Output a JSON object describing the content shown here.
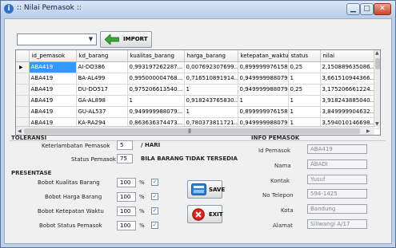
{
  "window": {
    "title": ":: Nilai Pemasok ::",
    "minimize": "▁",
    "maximize": "□",
    "close": "✕"
  },
  "toolbar": {
    "combo_value": "",
    "import_label": "IMPORT"
  },
  "grid": {
    "columns": [
      "id_pemasok",
      "kd_barang",
      "kualitas_barang",
      "harga_barang",
      "ketepatan_waktu",
      "status",
      "nilai"
    ],
    "rows": [
      [
        "ABA419",
        "AI-DO386",
        "0,993197262287...",
        "0,007692307699...",
        "0,899999976158...",
        "0,25",
        "2,150889635086..."
      ],
      [
        "ABA419",
        "BA-AL499",
        "0,995000004768...",
        "0,716510891914...",
        "0,949999988079...",
        "1",
        "3,661510944366..."
      ],
      [
        "ABA419",
        "DU-DO517",
        "0,975206613540...",
        "1",
        "0,949999988079...",
        "0,25",
        "3,175206661224..."
      ],
      [
        "ABA419",
        "GA-AL898",
        "1",
        "0,918243765830...",
        "1",
        "1",
        "3,918243885040..."
      ],
      [
        "ABA419",
        "GU-AL537",
        "0,949999988079...",
        "1",
        "0,899999976158...",
        "1",
        "3,849999904632..."
      ],
      [
        "ABA419",
        "KA-RA294",
        "0,863636374473...",
        "0,780373811721...",
        "0,949999988079...",
        "1",
        "3,594010146698..."
      ]
    ],
    "row_marker": "▶",
    "hscroll_grip": "|||"
  },
  "toleransi": {
    "heading": "TOLERANSI",
    "keterlambatan_label": "Keterlambatan Pemasok",
    "keterlambatan_dash": "-",
    "keterlambatan_value": "5",
    "keterlambatan_unit": "/ HARI",
    "status_label": "Status Pemasok",
    "status_dash": "-",
    "status_value": "75",
    "status_note": "BILA BARANG TIDAK TERSEDIA"
  },
  "presentase": {
    "heading": "PRESENTASE",
    "items": [
      {
        "label": "Bobot Kualitas Barang",
        "value": "100",
        "unit": "%",
        "checked": "✓"
      },
      {
        "label": "Bobot Harga Barang",
        "value": "100",
        "unit": "%",
        "checked": "✓"
      },
      {
        "label": "Bobot Ketepatan Waktu",
        "value": "100",
        "unit": "%",
        "checked": "✓"
      },
      {
        "label": "Bobot Status Pemasok",
        "value": "100",
        "unit": "%",
        "checked": "✓"
      }
    ]
  },
  "actions": {
    "save_label": "SAVE",
    "exit_label": "EXIT"
  },
  "info": {
    "heading": "INFO PEMASOK",
    "fields": [
      {
        "label": "Id Pemasok",
        "value": "ABA419"
      },
      {
        "label": "Nama",
        "value": "ABADI"
      },
      {
        "label": "Kontak",
        "value": "Yusuf"
      },
      {
        "label": "No Telepon",
        "value": "594-1425"
      },
      {
        "label": "Kota",
        "value": "Bandung"
      },
      {
        "label": "Alamat",
        "value": "Siliwangi A/17"
      }
    ]
  },
  "colors": {
    "selection": "#3399ff",
    "window_frame": "#bcd0ea",
    "close_button": "#c8442b"
  }
}
